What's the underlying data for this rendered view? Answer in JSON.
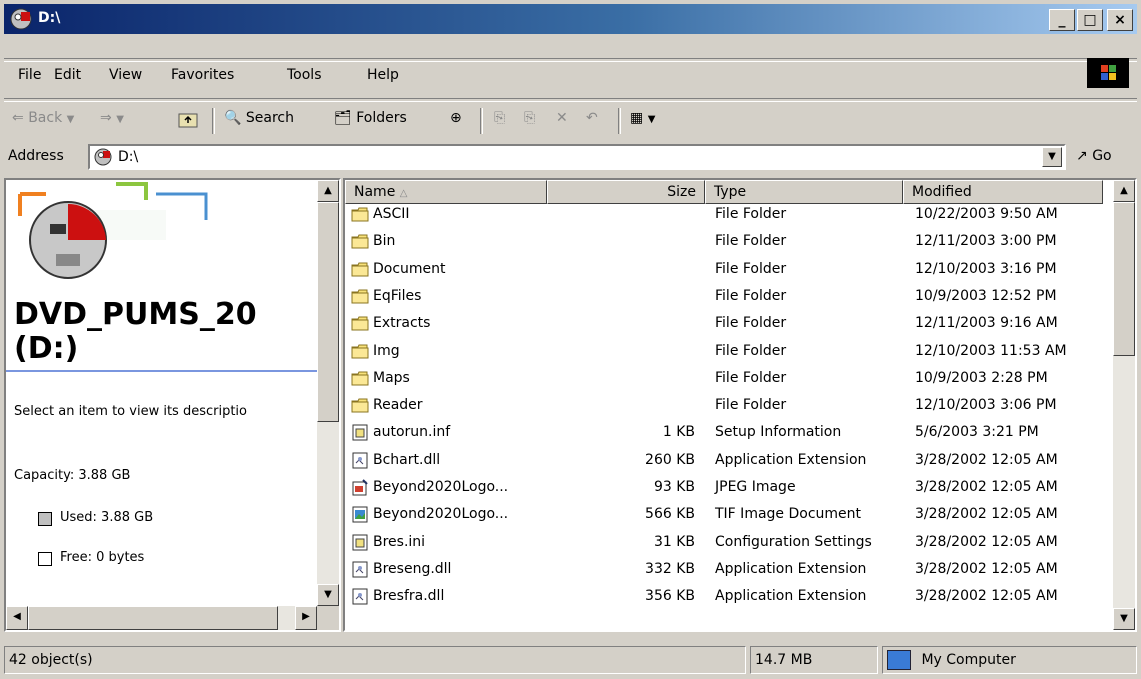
{
  "window": {
    "title": "D:\\"
  },
  "titlebar_buttons": {
    "minimize": "_",
    "maximize": "□",
    "close": "×"
  },
  "menu": [
    "File",
    "Edit",
    "View",
    "Favorites",
    "Tools",
    "Help"
  ],
  "toolbar": {
    "back": "Back",
    "search": "Search",
    "folders": "Folders"
  },
  "address": {
    "label": "Address",
    "value": "D:\\",
    "go": "Go"
  },
  "left_panel": {
    "drive_title_line1": "DVD_PUMS_20",
    "drive_title_line2": "(D:)",
    "description": "Select an item to view its descriptio",
    "capacity": "Capacity: 3.88 GB",
    "used": "Used: 3.88 GB",
    "free": "Free: 0 bytes"
  },
  "columns": [
    "Name",
    "Size",
    "Type",
    "Modified"
  ],
  "files": [
    {
      "name": "ASCII",
      "size": "",
      "type": "File Folder",
      "modified": "10/22/2003 9:50 AM",
      "icon": "folder-icon"
    },
    {
      "name": "Bin",
      "size": "",
      "type": "File Folder",
      "modified": "12/11/2003 3:00 PM",
      "icon": "folder-icon"
    },
    {
      "name": "Document",
      "size": "",
      "type": "File Folder",
      "modified": "12/10/2003 3:16 PM",
      "icon": "folder-icon"
    },
    {
      "name": "EqFiles",
      "size": "",
      "type": "File Folder",
      "modified": "10/9/2003 12:52 PM",
      "icon": "folder-icon"
    },
    {
      "name": "Extracts",
      "size": "",
      "type": "File Folder",
      "modified": "12/11/2003 9:16 AM",
      "icon": "folder-icon"
    },
    {
      "name": "Img",
      "size": "",
      "type": "File Folder",
      "modified": "12/10/2003 11:53 AM",
      "icon": "folder-icon"
    },
    {
      "name": "Maps",
      "size": "",
      "type": "File Folder",
      "modified": "10/9/2003 2:28 PM",
      "icon": "folder-icon"
    },
    {
      "name": "Reader",
      "size": "",
      "type": "File Folder",
      "modified": "12/10/2003 3:06 PM",
      "icon": "folder-icon"
    },
    {
      "name": "autorun.inf",
      "size": "1 KB",
      "type": "Setup Information",
      "modified": "5/6/2003 3:21 PM",
      "icon": "setup-file-icon"
    },
    {
      "name": "Bchart.dll",
      "size": "260 KB",
      "type": "Application Extension",
      "modified": "3/28/2002 12:05 AM",
      "icon": "dll-file-icon"
    },
    {
      "name": "Beyond2020Logo...",
      "size": "93 KB",
      "type": "JPEG Image",
      "modified": "3/28/2002 12:05 AM",
      "icon": "jpeg-file-icon"
    },
    {
      "name": "Beyond2020Logo...",
      "size": "566 KB",
      "type": "TIF Image Document",
      "modified": "3/28/2002 12:05 AM",
      "icon": "tif-file-icon"
    },
    {
      "name": "Bres.ini",
      "size": "31 KB",
      "type": "Configuration Settings",
      "modified": "3/28/2002 12:05 AM",
      "icon": "setup-file-icon"
    },
    {
      "name": "Breseng.dll",
      "size": "332 KB",
      "type": "Application Extension",
      "modified": "3/28/2002 12:05 AM",
      "icon": "dll-file-icon"
    },
    {
      "name": "Bresfra.dll",
      "size": "356 KB",
      "type": "Application Extension",
      "modified": "3/28/2002 12:05 AM",
      "icon": "dll-file-icon"
    }
  ],
  "status": {
    "objects": "42 object(s)",
    "size": "14.7 MB",
    "zone": "My Computer"
  }
}
